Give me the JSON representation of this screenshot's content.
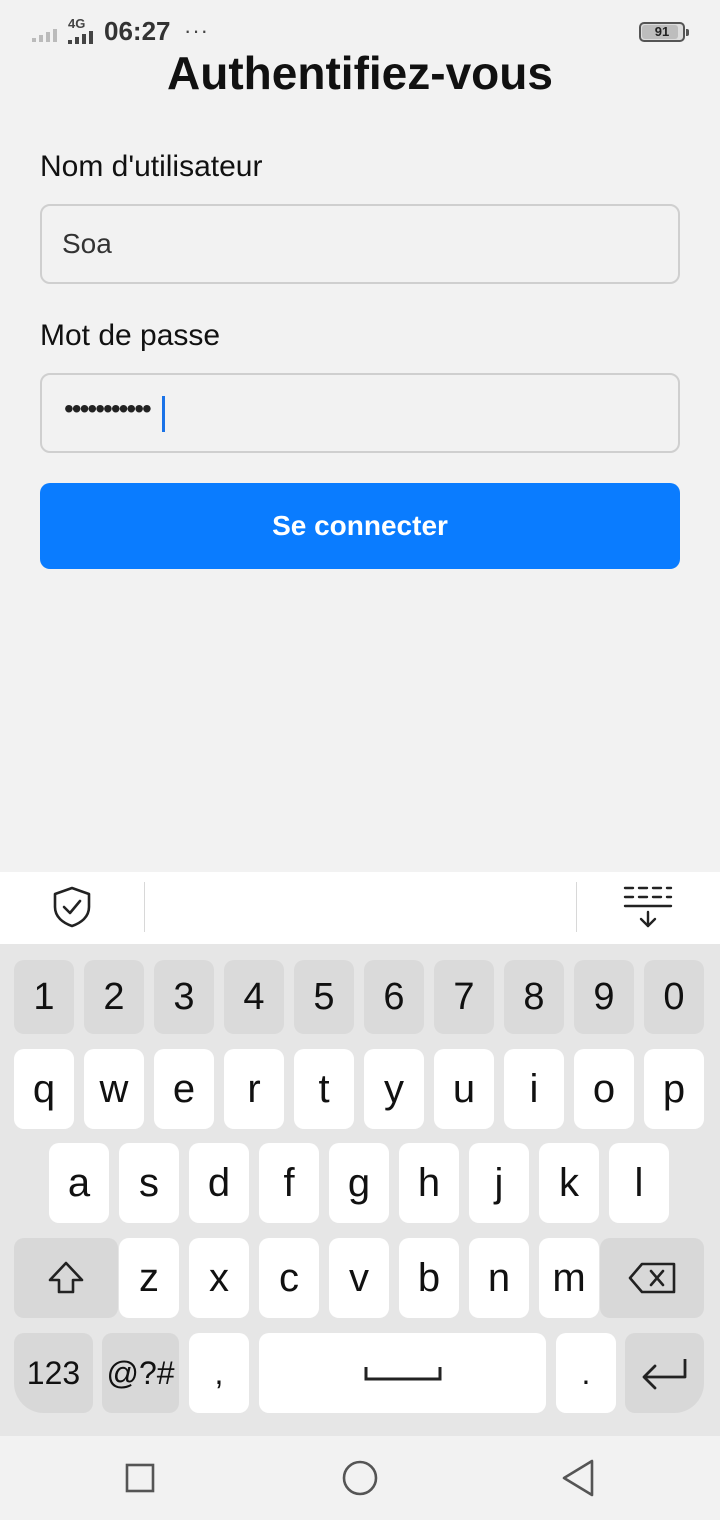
{
  "status_bar": {
    "network": "4G",
    "time": "06:27",
    "more": "···",
    "battery": "91",
    "battery_level": 0.91
  },
  "page": {
    "title": "Authentifiez-vous"
  },
  "form": {
    "username_label": "Nom d'utilisateur",
    "username_value": "Soa",
    "password_label": "Mot de passe",
    "password_masked": "•••••••••••",
    "submit_label": "Se connecter"
  },
  "keyboard": {
    "number_row": [
      "1",
      "2",
      "3",
      "4",
      "5",
      "6",
      "7",
      "8",
      "9",
      "0"
    ],
    "row1": [
      "q",
      "w",
      "e",
      "r",
      "t",
      "y",
      "u",
      "i",
      "o",
      "p"
    ],
    "row2": [
      "a",
      "s",
      "d",
      "f",
      "g",
      "h",
      "j",
      "k",
      "l"
    ],
    "row3": [
      "z",
      "x",
      "c",
      "v",
      "b",
      "n",
      "m"
    ],
    "numbers_key": "123",
    "symbols_key": "@?#",
    "comma_key": ",",
    "period_key": "."
  },
  "colors": {
    "accent": "#0a7cff",
    "background": "#f2f2f2"
  }
}
